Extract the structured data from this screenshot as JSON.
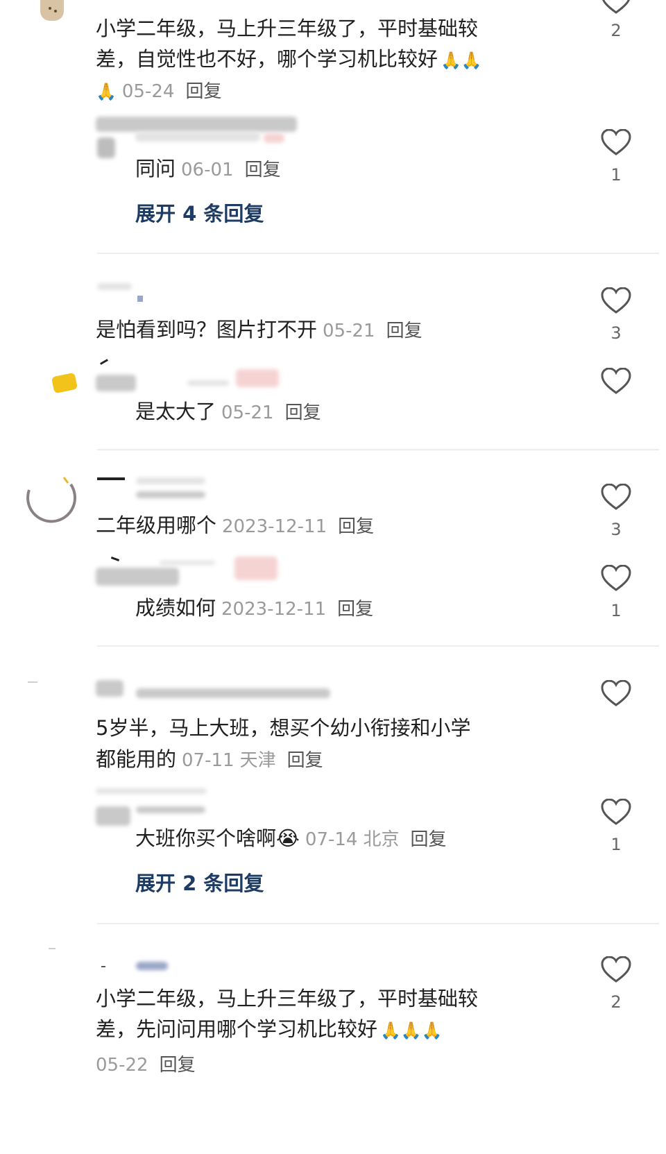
{
  "comments": [
    {
      "text_line1": "小学二年级，马上升三年级了，平时基础较",
      "text_line2": "差，自觉性也不好，哪个学习机比较好",
      "emoji_inline": "🙏🙏",
      "emoji_lead": "🙏",
      "date": "05-24",
      "reply_label": "回复",
      "likes": "2",
      "sub_reply": {
        "text": "同问",
        "date": "06-01",
        "reply_label": "回复",
        "likes": "1"
      },
      "expand_label": "展开 4 条回复"
    },
    {
      "text": "是怕看到吗？图片打不开",
      "date": "05-21",
      "reply_label": "回复",
      "likes": "3",
      "sub_reply": {
        "text": "是太大了",
        "date": "05-21",
        "reply_label": "回复"
      }
    },
    {
      "text": "二年级用哪个",
      "date": "2023-12-11",
      "reply_label": "回复",
      "likes": "3",
      "sub_reply": {
        "text": "成绩如何",
        "date": "2023-12-11",
        "reply_label": "回复",
        "likes": "1"
      }
    },
    {
      "text_line1": "5岁半，马上大班，想买个幼小衔接和小学",
      "text_line2": "都能用的",
      "date": "07-11",
      "location": "天津",
      "reply_label": "回复",
      "sub_reply": {
        "text": "大班你买个啥啊",
        "emoji": "😭",
        "date": "07-14",
        "location": "北京",
        "reply_label": "回复",
        "likes": "1"
      },
      "expand_label": "展开 2 条回复"
    },
    {
      "text_line1": "小学二年级，马上升三年级了，平时基础较",
      "text_line2": "差，先问问用哪个学习机比较好",
      "emoji_inline": "🙏🙏🙏",
      "date": "05-22",
      "reply_label": "回复",
      "likes": "2"
    }
  ],
  "colors": {
    "expand": "#1e3c63",
    "meta": "#9a9a9a",
    "divider": "#eeeeee"
  },
  "icons": {
    "like": "heart-outline-icon"
  }
}
